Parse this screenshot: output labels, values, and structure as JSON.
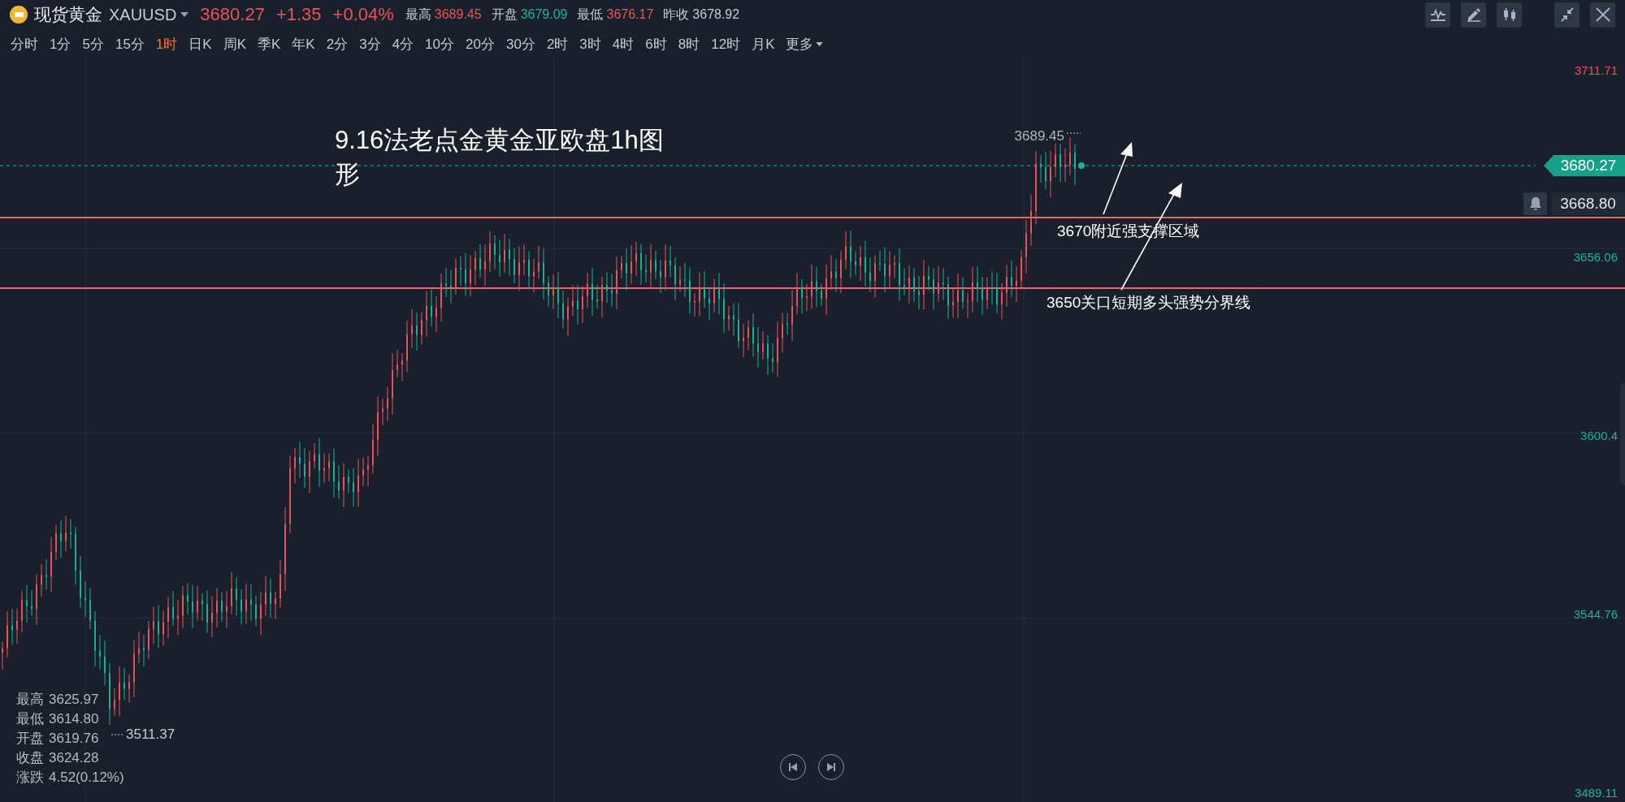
{
  "header": {
    "symbol_name": "现货黄金",
    "symbol_code": "XAUUSD",
    "price": "3680.27",
    "change": "+1.35",
    "change_pct": "+0.04%",
    "stats": [
      {
        "label": "最高",
        "value": "3689.45",
        "color": "#e8545a"
      },
      {
        "label": "开盘",
        "value": "3679.09",
        "color": "#19b394"
      },
      {
        "label": "最低",
        "value": "3676.17",
        "color": "#e8545a"
      },
      {
        "label": "昨收",
        "value": "3678.92",
        "color": "#c4c8d0"
      }
    ]
  },
  "timeframes": [
    {
      "label": "分时",
      "selected": false
    },
    {
      "label": "1分",
      "selected": false
    },
    {
      "label": "5分",
      "selected": false
    },
    {
      "label": "15分",
      "selected": false
    },
    {
      "label": "1时",
      "selected": true
    },
    {
      "label": "日K",
      "selected": false
    },
    {
      "label": "周K",
      "selected": false
    },
    {
      "label": "季K",
      "selected": false
    },
    {
      "label": "年K",
      "selected": false
    },
    {
      "label": "2分",
      "selected": false
    },
    {
      "label": "3分",
      "selected": false
    },
    {
      "label": "4分",
      "selected": false
    },
    {
      "label": "10分",
      "selected": false
    },
    {
      "label": "20分",
      "selected": false
    },
    {
      "label": "30分",
      "selected": false
    },
    {
      "label": "2时",
      "selected": false
    },
    {
      "label": "3时",
      "selected": false
    },
    {
      "label": "4时",
      "selected": false
    },
    {
      "label": "6时",
      "selected": false
    },
    {
      "label": "8时",
      "selected": false
    },
    {
      "label": "12时",
      "selected": false
    },
    {
      "label": "月K",
      "selected": false
    }
  ],
  "more_label": "更多",
  "chart": {
    "title": "9.16法老点金黄金亚欧盘1h图形",
    "annotations": [
      "3670附近强支撑区域",
      "3650关口短期多头强势分界线"
    ],
    "high_label": "3689.45",
    "low_label": "3511.37",
    "price_tag": "3680.27",
    "alert_price": "3668.80",
    "y_axis_labels": [
      {
        "text": "3711.71",
        "color": "#e8545a"
      },
      {
        "text": "3656.06",
        "color": "#19b394"
      },
      {
        "text": "3600.4",
        "color": "#19b394"
      },
      {
        "text": "3544.76",
        "color": "#19b394"
      },
      {
        "text": "3489.11",
        "color": "#19b394"
      }
    ],
    "ohlc_info": [
      {
        "label": "最高",
        "value": "3625.97"
      },
      {
        "label": "最低",
        "value": "3614.80"
      },
      {
        "label": "开盘",
        "value": "3619.76"
      },
      {
        "label": "收盘",
        "value": "3624.28"
      },
      {
        "label": "涨跌",
        "value": "4.52(0.12%)"
      }
    ]
  }
}
